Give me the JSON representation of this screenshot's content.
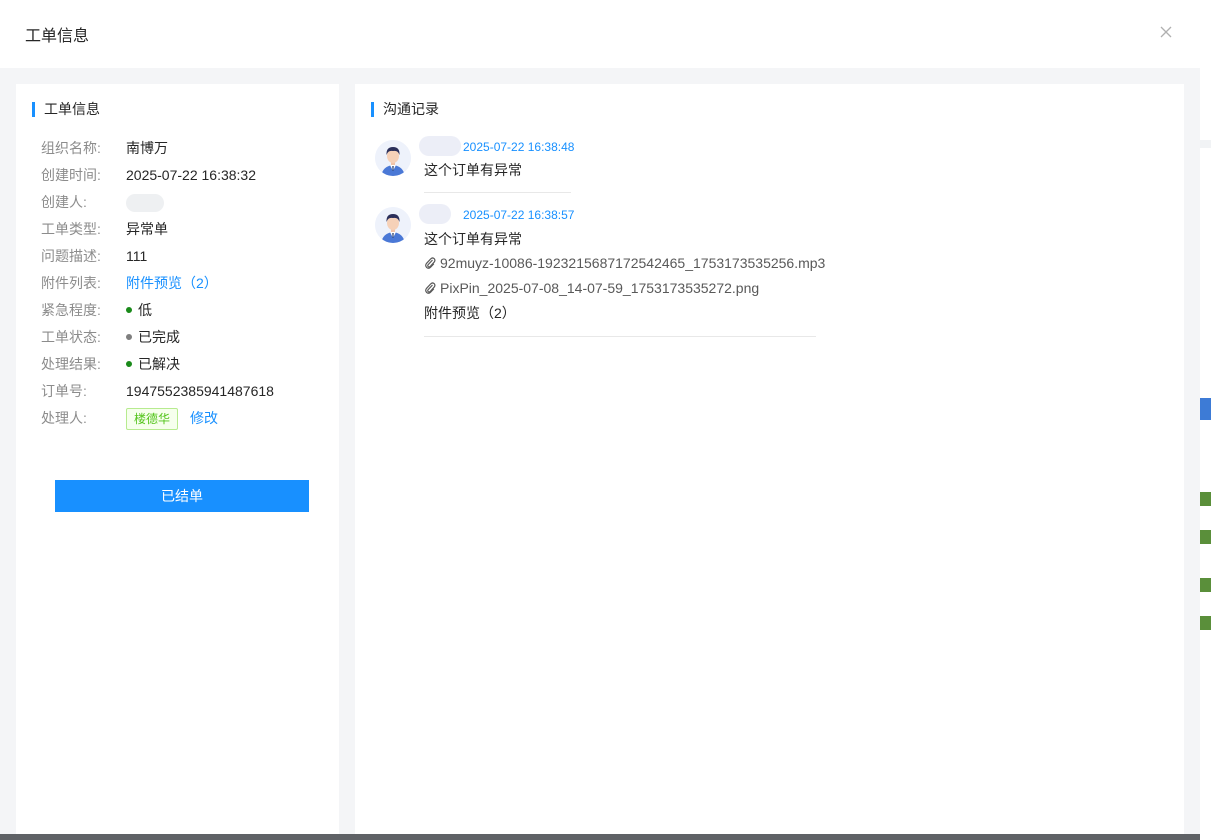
{
  "modal": {
    "title": "工单信息"
  },
  "left_panel": {
    "section_title": "工单信息",
    "rows": [
      {
        "label": "组织名称:",
        "value": "南博万"
      },
      {
        "label": "创建时间:",
        "value": "2025-07-22 16:38:32"
      },
      {
        "label": "创建人:",
        "value": ""
      },
      {
        "label": "工单类型:",
        "value": "异常单"
      },
      {
        "label": "问题描述:",
        "value": "111"
      },
      {
        "label": "附件列表:",
        "value": "附件预览（2）"
      },
      {
        "label": "紧急程度:",
        "value": "低",
        "dot_color": "#1a8a1a"
      },
      {
        "label": "工单状态:",
        "value": "已完成",
        "dot_color": "#7f7f7f"
      },
      {
        "label": "处理结果:",
        "value": "已解决",
        "dot_color": "#1a8a1a"
      },
      {
        "label": "订单号:",
        "value": "1947552385941487618"
      },
      {
        "label": "处理人:",
        "value": "楼德华",
        "edit_label": "修改"
      }
    ],
    "action_button": "已结单"
  },
  "right_panel": {
    "section_title": "沟通记录",
    "messages": [
      {
        "time": "2025-07-22 16:38:48",
        "text": "这个订单有异常",
        "attachments": []
      },
      {
        "time": "2025-07-22 16:38:57",
        "text": "这个订单有异常",
        "attachments": [
          "92muyz-10086-1923215687172542465_1753173535256.mp3",
          "PixPin_2025-07-08_14-07-59_1753173535272.png"
        ],
        "preview_label": "附件预览（2）"
      }
    ]
  },
  "colors": {
    "accent": "#1890ff",
    "tag_green": "#52c41a"
  }
}
